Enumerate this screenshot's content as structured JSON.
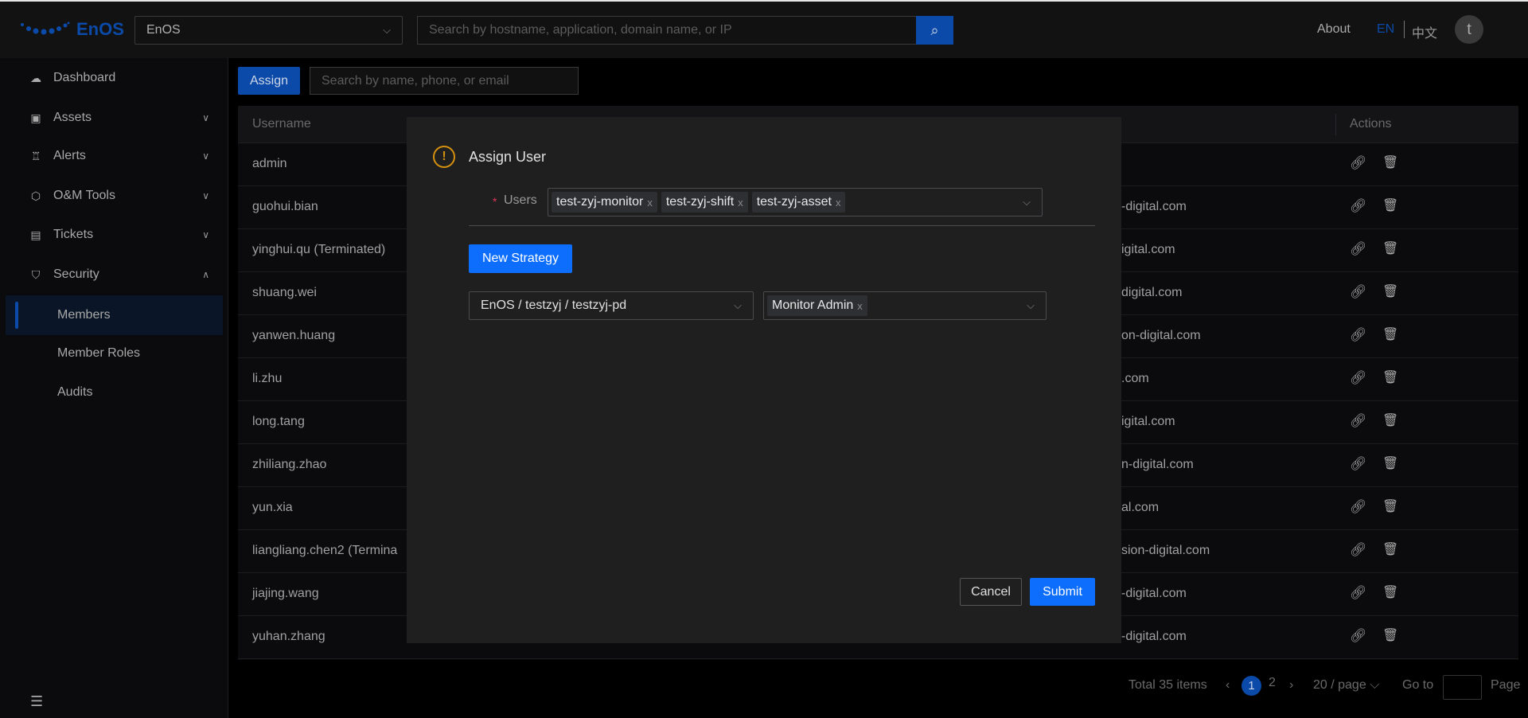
{
  "header": {
    "logo": "EnOS",
    "org_select": "EnOS",
    "search_placeholder": "Search by hostname, application, domain name, or IP",
    "about": "About",
    "lang_en": "EN",
    "lang_zh": "中文",
    "avatar": "t",
    "accent": "#0b4aa8"
  },
  "sidebar": {
    "items": [
      {
        "label": "Dashboard",
        "icon": "cloud-upload-icon"
      },
      {
        "label": "Assets",
        "icon": "assets-icon"
      },
      {
        "label": "Alerts",
        "icon": "alarm-icon"
      },
      {
        "label": "O&M Tools",
        "icon": "toolbox-icon"
      },
      {
        "label": "Tickets",
        "icon": "ticket-icon"
      },
      {
        "label": "Security",
        "icon": "shield-icon"
      }
    ],
    "sub_items": [
      "Members",
      "Member Roles",
      "Audits"
    ],
    "active": "Members"
  },
  "toolbar": {
    "assign": "Assign",
    "search_placeholder": "Search by name, phone, or email"
  },
  "table": {
    "headers": {
      "username": "Username",
      "actions": "Actions"
    },
    "rows": [
      {
        "u": "admin",
        "e": ""
      },
      {
        "u": "guohui.bian",
        "e": "-digital.com"
      },
      {
        "u": "yinghui.qu (Terminated)",
        "e": "igital.com"
      },
      {
        "u": "shuang.wei",
        "e": "digital.com"
      },
      {
        "u": "yanwen.huang",
        "e": "on-digital.com"
      },
      {
        "u": "li.zhu",
        "e": ".com"
      },
      {
        "u": "long.tang",
        "e": "igital.com"
      },
      {
        "u": "zhiliang.zhao",
        "e": "n-digital.com"
      },
      {
        "u": "yun.xia",
        "e": "al.com"
      },
      {
        "u": "liangliang.chen2 (Termina",
        "e": "sion-digital.com"
      },
      {
        "u": "jiajing.wang",
        "e": "-digital.com"
      },
      {
        "u": "yuhan.zhang",
        "e": "-digital.com"
      }
    ]
  },
  "pagination": {
    "total": "Total 35 items",
    "pages": [
      "1",
      "2"
    ],
    "current": "1",
    "page_size": "20 / page",
    "goto": "Go to",
    "page": "Page"
  },
  "modal": {
    "title": "Assign User",
    "users_label": "Users",
    "required": "*",
    "users": [
      "test-zyj-monitor",
      "test-zyj-shift",
      "test-zyj-asset"
    ],
    "new_strategy": "New Strategy",
    "org_path": "EnOS / testzyj / testzyj-pd",
    "roles": [
      "Monitor Admin"
    ],
    "cancel": "Cancel",
    "submit": "Submit",
    "warning_color": "#d4910f",
    "primary_color": "#0d6efd"
  }
}
